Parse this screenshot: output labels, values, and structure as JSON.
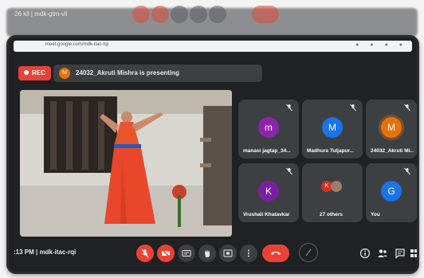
{
  "background_toolbar": {
    "left_text": "26 kll | mdk-gtm-vll"
  },
  "browser": {
    "address": "meet.google.com/mdk-itac-rqi"
  },
  "recording": {
    "label": "REC"
  },
  "presenting_banner": {
    "avatar_letter": "M",
    "text": "24032_Akruti Mishra is presenting"
  },
  "participants": [
    {
      "name": "manasi jagtap_34...",
      "letter": "m",
      "color": "#8e24aa"
    },
    {
      "name": "Madhura Tuljapur...",
      "letter": "M",
      "color": "#1a73e8"
    },
    {
      "name": "24032_Akruti Mi...",
      "letter": "M",
      "color": "#e8710a"
    },
    {
      "name": "Vrushali Khatavkar",
      "letter": "K",
      "color": "#7b1fa2"
    },
    {
      "name": "27 others",
      "letter": "K",
      "color": "#d93025"
    },
    {
      "name": "You",
      "letter": "G",
      "color": "#1a73e8"
    }
  ],
  "meeting": {
    "time": ":13 PM",
    "separator": "|",
    "code": "mdk-itac-rqi"
  },
  "colors": {
    "panel": "#1f2124",
    "tile": "#3c4043",
    "danger": "#ea4335"
  },
  "icons": [
    "mic-off-icon",
    "camera-off-icon",
    "captions-icon",
    "raise-hand-icon",
    "present-icon",
    "more-icon",
    "end-call-icon",
    "pen-icon",
    "info-icon",
    "people-icon",
    "chat-icon",
    "activities-icon"
  ]
}
